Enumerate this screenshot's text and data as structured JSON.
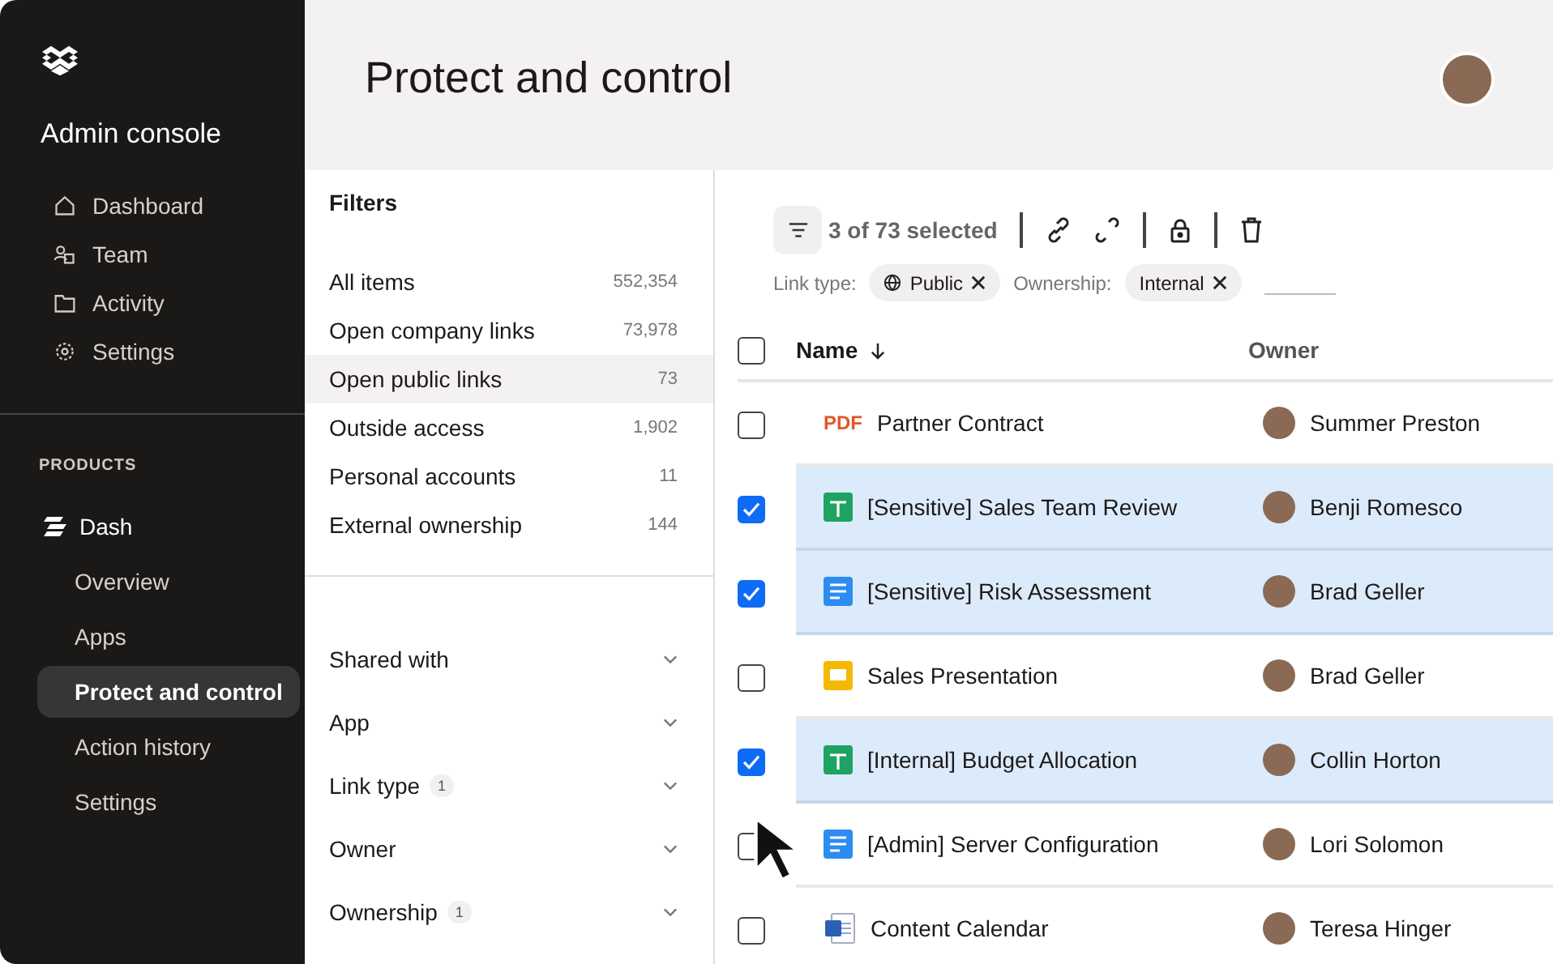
{
  "sidebar": {
    "title": "Admin console",
    "nav": [
      {
        "label": "Dashboard"
      },
      {
        "label": "Team"
      },
      {
        "label": "Activity"
      },
      {
        "label": "Settings"
      }
    ],
    "section": "PRODUCTS",
    "product": "Dash",
    "items": [
      {
        "label": "Overview",
        "selected": false
      },
      {
        "label": "Apps",
        "selected": false
      },
      {
        "label": "Protect and control",
        "selected": true
      },
      {
        "label": "Action history",
        "selected": false
      },
      {
        "label": "Settings",
        "selected": false
      }
    ]
  },
  "header": {
    "title": "Protect and control"
  },
  "filters": {
    "title": "Filters",
    "items": [
      {
        "label": "All items",
        "count": "552,354",
        "selected": false
      },
      {
        "label": "Open company links",
        "count": "73,978",
        "selected": false
      },
      {
        "label": "Open public links",
        "count": "73",
        "selected": true
      },
      {
        "label": "Outside access",
        "count": "1,902",
        "selected": false
      },
      {
        "label": "Personal accounts",
        "count": "11",
        "selected": false
      },
      {
        "label": "External ownership",
        "count": "144",
        "selected": false
      }
    ],
    "groups": [
      {
        "label": "Shared with"
      },
      {
        "label": "App"
      },
      {
        "label": "Link type",
        "badge": "1"
      },
      {
        "label": "Owner"
      },
      {
        "label": "Ownership",
        "badge": "1"
      }
    ]
  },
  "toolbar": {
    "selection": "3 of 73 selected"
  },
  "chips": [
    {
      "label": "Link type:",
      "value": "Public",
      "kind": "link-type"
    },
    {
      "label": "Ownership:",
      "value": "Internal",
      "kind": "ownership"
    }
  ],
  "table": {
    "columns": [
      "Name",
      "Owner"
    ],
    "all_checked": false,
    "rows": [
      {
        "name": "Partner Contract",
        "kind": "pdf",
        "badge": "PDF",
        "owner": "Summer Preston",
        "selected": false
      },
      {
        "name": "[Sensitive] Sales Team Review",
        "kind": "sheet",
        "owner": "Benji Romesco",
        "selected": true
      },
      {
        "name": "[Sensitive] Risk Assessment",
        "kind": "doc",
        "owner": "Brad Geller",
        "selected": true
      },
      {
        "name": "Sales Presentation",
        "kind": "slides",
        "owner": "Brad Geller",
        "selected": false
      },
      {
        "name": "[Internal] Budget Allocation",
        "kind": "sheet",
        "owner": "Collin Horton",
        "selected": true
      },
      {
        "name": "[Admin] Server Configuration",
        "kind": "doc",
        "owner": "Lori Solomon",
        "selected": false
      },
      {
        "name": "Content Calendar",
        "kind": "word",
        "owner": "Teresa Hinger",
        "selected": false
      }
    ]
  }
}
